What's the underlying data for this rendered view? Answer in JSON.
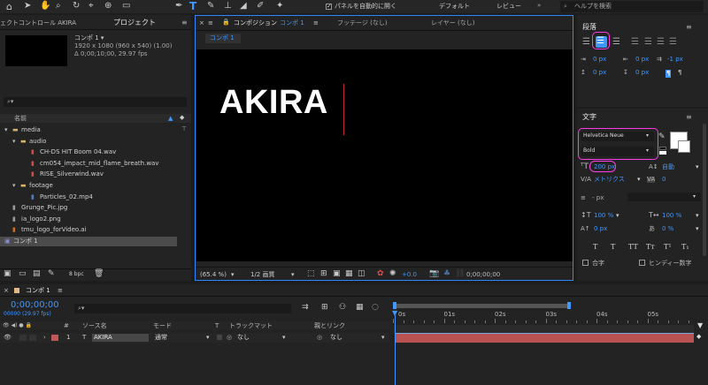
{
  "toolbar": {
    "auto_open_label": "パネルを自動的に開く",
    "workspace_default": "デフォルト",
    "workspace_review": "レビュー",
    "search_placeholder": "ヘルプを検索"
  },
  "project": {
    "tab_effects": "ェクトコントロール AKIRA",
    "tab_project": "プロジェクト",
    "comp_name": "コンポ 1 ▾",
    "comp_size": "1920 x 1080 (960 x 540) (1.00)",
    "comp_duration": "Δ 0;00;10;00, 29.97 fps",
    "search_placeholder": "⌕▾",
    "column_name": "名前",
    "bpc": "8 bpc",
    "tree": [
      {
        "label": "media",
        "indent": 0,
        "icon": "folder",
        "arrow": "▾"
      },
      {
        "label": "audio",
        "indent": 1,
        "icon": "folder",
        "arrow": "▾"
      },
      {
        "label": "CH-DS HIT Boom 04.wav",
        "indent": 2,
        "icon": "audio-file",
        "arrow": ""
      },
      {
        "label": "cm054_impact_mid_flame_breath.wav",
        "indent": 2,
        "icon": "audio-file",
        "arrow": ""
      },
      {
        "label": "RISE_Silverwind.wav",
        "indent": 2,
        "icon": "audio-file",
        "arrow": ""
      },
      {
        "label": "footage",
        "indent": 1,
        "icon": "folder",
        "arrow": "▾"
      },
      {
        "label": "Particles_02.mp4",
        "indent": 2,
        "icon": "video-file",
        "arrow": ""
      },
      {
        "label": "Grunge_Pic.jpg",
        "indent": 1,
        "icon": "image-file",
        "arrow": ""
      },
      {
        "label": "ia_logo2.png",
        "indent": 1,
        "icon": "image-file",
        "arrow": ""
      },
      {
        "label": "tmu_logo_forVideo.ai",
        "indent": 1,
        "icon": "ai-file",
        "arrow": ""
      },
      {
        "label": "コンポ 1",
        "indent": 0,
        "icon": "comp",
        "arrow": ""
      }
    ]
  },
  "viewer": {
    "tab_composition": "コンポジション",
    "tab_comp_name": "コンポ 1",
    "tab_footage": "フッテージ (なし)",
    "tab_layer": "レイヤー (なし)",
    "comp_chip": "コンポ 1",
    "canvas_text": "AKIRA",
    "zoom": "(65.4 %)",
    "resolution": "1/2 画質",
    "exposure": "+0.0",
    "timecode": "0;00;00;00"
  },
  "paragraph": {
    "title": "段落",
    "indent_left": "0 px",
    "indent_right": "0 px",
    "space_before": "0 px",
    "space_after": "0 px",
    "indent_first": "-1 px"
  },
  "character": {
    "title": "文字",
    "font_family": "Helvetica Neue",
    "font_style": "Bold",
    "font_size": "200 px",
    "leading": "自動",
    "kerning": "メトリクス",
    "tracking": "0",
    "stroke": "- px",
    "v_scale": "100 %",
    "h_scale": "100 %",
    "baseline": "0 px",
    "tsume": "0 %",
    "ligatures_label": "合字",
    "hindi_label": "ヒンディー数字",
    "style_buttons": [
      "T",
      "T",
      "TT",
      "Tт",
      "T¹",
      "T₁"
    ]
  },
  "timeline": {
    "tab": "コンポ 1",
    "timecode": "0;00;00;00",
    "timecode_sub": "00000 (29.97 fps)",
    "search_placeholder": "⌕▾",
    "col_num": "#",
    "col_source": "ソース名",
    "col_mode": "モード",
    "col_t": "T",
    "col_trackmatte": "トラックマット",
    "col_parent": "親とリンク",
    "ruler": [
      "0s",
      "01s",
      "02s",
      "03s",
      "04s",
      "05s"
    ],
    "layer": {
      "num": "1",
      "type": "T",
      "name": "AKIRA",
      "mode": "通常",
      "matte": "なし",
      "parent": "なし"
    }
  },
  "colors": {
    "accent": "#3f97ff",
    "highlight": "#ff3ce8",
    "layer_bar": "#b85152"
  }
}
